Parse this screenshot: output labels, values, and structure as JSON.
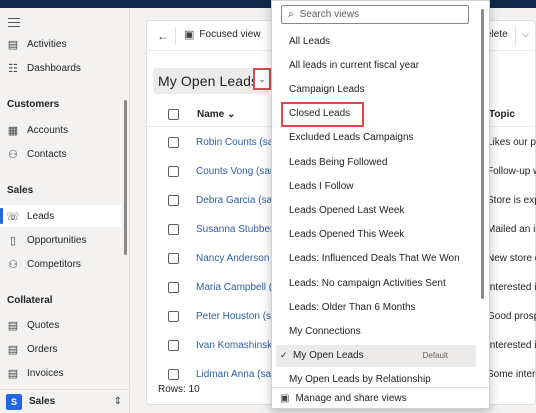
{
  "sidebar": {
    "items_top": [
      {
        "label": "Activities",
        "icon": "clipboard-icon"
      },
      {
        "label": "Dashboards",
        "icon": "dashboard-icon"
      }
    ],
    "sections": [
      {
        "header": "Customers",
        "items": [
          {
            "label": "Accounts",
            "icon": "building-icon"
          },
          {
            "label": "Contacts",
            "icon": "person-icon"
          }
        ]
      },
      {
        "header": "Sales",
        "items": [
          {
            "label": "Leads",
            "icon": "phone-icon",
            "active": true
          },
          {
            "label": "Opportunities",
            "icon": "document-icon"
          },
          {
            "label": "Competitors",
            "icon": "person-icon"
          }
        ]
      },
      {
        "header": "Collateral",
        "items": [
          {
            "label": "Quotes",
            "icon": "document-icon"
          },
          {
            "label": "Orders",
            "icon": "document-icon"
          },
          {
            "label": "Invoices",
            "icon": "document-icon"
          }
        ]
      }
    ],
    "area": {
      "badge": "S",
      "label": "Sales"
    }
  },
  "toolbar": {
    "focused_view_label": "Focused view",
    "delete_label": "elete"
  },
  "view": {
    "title": "My Open Leads"
  },
  "grid": {
    "columns": {
      "name": "Name",
      "topic": "Topic"
    },
    "rows": [
      {
        "name": "Robin Counts (sam",
        "topic": "Likes our p"
      },
      {
        "name": "Counts Vong (sam",
        "topic": "Follow-up w"
      },
      {
        "name": "Debra Garcia (sam",
        "topic": "Store is exp"
      },
      {
        "name": "Susanna Stubbero",
        "topic": "Mailed an in"
      },
      {
        "name": "Nancy Anderson (s",
        "topic": "New store o"
      },
      {
        "name": "Maria Campbell (s",
        "topic": "Interested i"
      },
      {
        "name": "Peter Houston (sar",
        "topic": "Good prosp"
      },
      {
        "name": "Ivan Komashinsky",
        "topic": "Interested i"
      },
      {
        "name": "Lidman Anna (sam",
        "topic": "Some intere"
      }
    ],
    "rows_count": "Rows: 10"
  },
  "views_dropdown": {
    "search_placeholder": "Search views",
    "items": [
      {
        "label": "All Leads"
      },
      {
        "label": "All leads in current fiscal year"
      },
      {
        "label": "Campaign Leads"
      },
      {
        "label": "Closed Leads"
      },
      {
        "label": "Excluded Leads Campaigns"
      },
      {
        "label": "Leads Being Followed"
      },
      {
        "label": "Leads I Follow"
      },
      {
        "label": "Leads Opened Last Week"
      },
      {
        "label": "Leads Opened This Week"
      },
      {
        "label": "Leads: Influenced Deals That We Won"
      },
      {
        "label": "Leads: No campaign Activities Sent"
      },
      {
        "label": "Leads: Older Than 6 Months"
      },
      {
        "label": "My Connections"
      },
      {
        "label": "My Open Leads",
        "selected": true,
        "default_label": "Default"
      },
      {
        "label": "My Open Leads by Relationship"
      }
    ],
    "footer_label": "Manage and share views"
  },
  "colors": {
    "accent": "#2266e3",
    "highlight_red": "#e0474c",
    "link_blue": "#2f5f9f"
  }
}
